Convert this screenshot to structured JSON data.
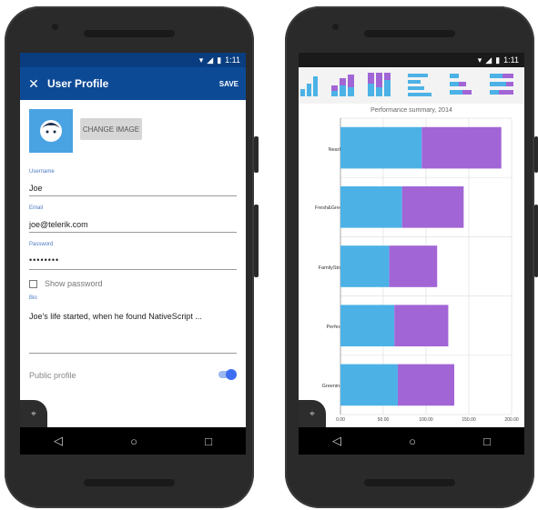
{
  "left": {
    "status_time": "1:11",
    "appbar": {
      "title": "User Profile",
      "save_label": "SAVE",
      "close_icon": "close-icon"
    },
    "change_image_label": "CHANGE IMAGE",
    "fields": {
      "username": {
        "label": "Username",
        "value": "Joe"
      },
      "email": {
        "label": "Email",
        "value": "joe@telerik.com"
      },
      "password": {
        "label": "Password",
        "value": "••••••••"
      },
      "show_password": "Show password",
      "bio": {
        "label": "Bio",
        "value": "Joe's life started, when he found NativeScript ..."
      }
    },
    "public_profile": {
      "label": "Public profile",
      "enabled": true
    },
    "colors": {
      "appbar": "#0d4a96",
      "accent": "#3d6ef2",
      "avatar": "#49a3e3"
    }
  },
  "right": {
    "status_time": "1:11",
    "chart_data": {
      "type": "bar",
      "orientation": "horizontal",
      "stacked": true,
      "title": "Performance summary, 2014",
      "categories": [
        "NearBy",
        "Fresh&Green",
        "FamilyStore",
        "Perfecto",
        "Greenings"
      ],
      "series": [
        {
          "values": [
            95,
            72,
            57,
            63,
            67
          ],
          "color": "#4cb2e6"
        },
        {
          "values": [
            93,
            72,
            56,
            63,
            66
          ],
          "color": "#a265d6"
        }
      ],
      "x_ticks": [
        "0.00",
        "50.00",
        "100.00",
        "150.00",
        "200.00"
      ],
      "xlim": [
        0,
        200
      ],
      "grid": true
    }
  }
}
